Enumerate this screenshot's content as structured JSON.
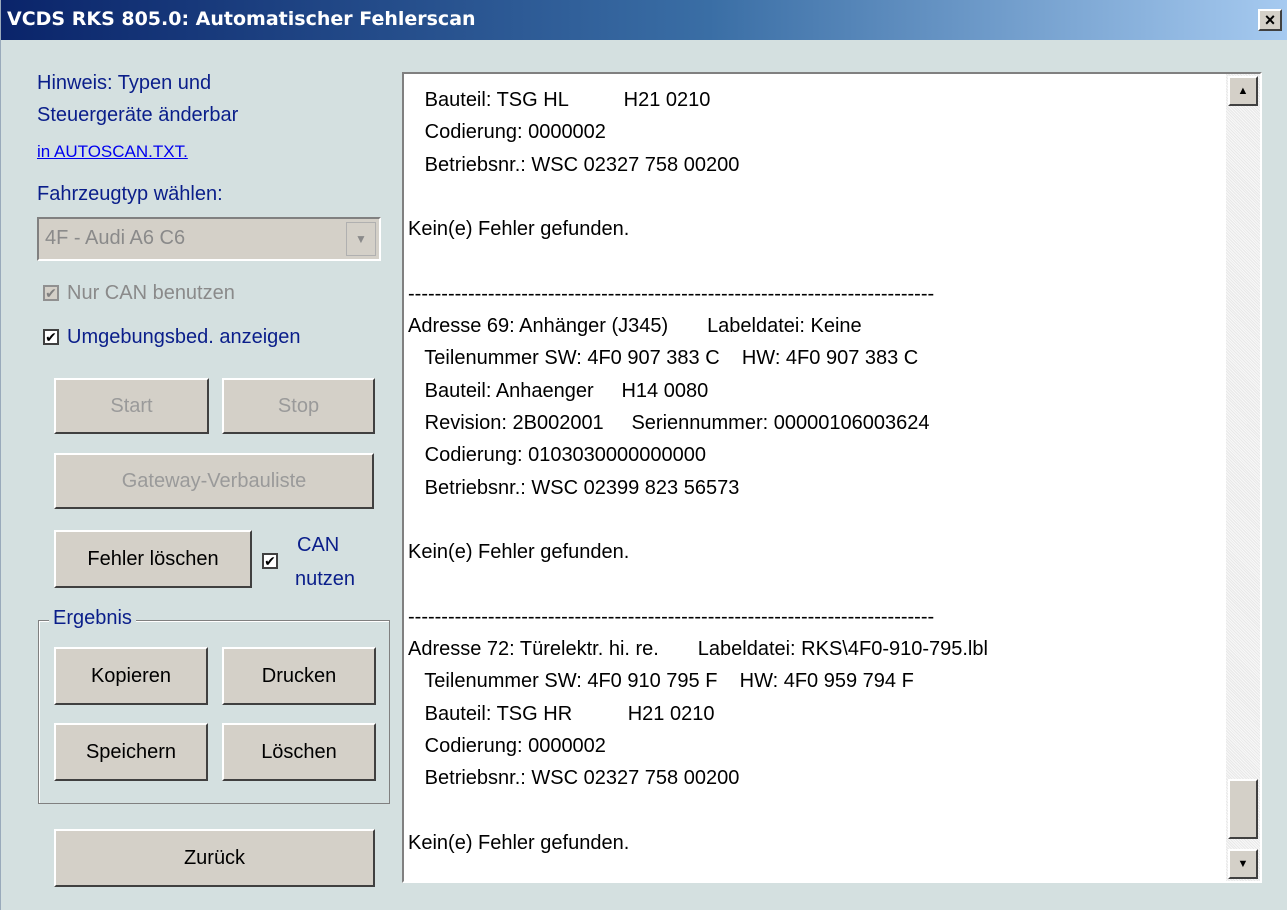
{
  "window": {
    "title": "VCDS RKS 805.0: Automatischer Fehlerscan",
    "close_label": "×"
  },
  "sidebar": {
    "hint_line1": "Hinweis: Typen und",
    "hint_line2": "Steuergeräte änderbar",
    "hint_link": "in AUTOSCAN.TXT.",
    "vehicle_label": "Fahrzeugtyp wählen:",
    "vehicle_select": {
      "value": "4F - Audi A6 C6",
      "arrow": "▼"
    },
    "can_only": {
      "label": "Nur CAN benutzen",
      "checked": true,
      "disabled": true,
      "mark": "✔"
    },
    "env_data": {
      "label": "Umgebungsbed. anzeigen",
      "checked": true,
      "mark": "✔"
    },
    "start_label": "Start",
    "stop_label": "Stop",
    "gateway_label": "Gateway-Verbauliste",
    "clear_errors_label": "Fehler löschen",
    "can_use": {
      "label_line1": "CAN",
      "label_line2": "nutzen",
      "checked": true,
      "mark": "✔"
    },
    "result_group": {
      "legend": "Ergebnis",
      "copy_label": "Kopieren",
      "print_label": "Drucken",
      "save_label": "Speichern",
      "delete_label": "Löschen"
    },
    "back_label": "Zurück"
  },
  "output": {
    "lines": [
      "   Bauteil: TSG HL          H21 0210",
      "   Codierung: 0000002",
      "   Betriebsnr.: WSC 02327 758 00200",
      "",
      "Kein(e) Fehler gefunden.",
      "",
      "-------------------------------------------------------------------------------",
      "Adresse 69: Anhänger (J345)       Labeldatei: Keine",
      "   Teilenummer SW: 4F0 907 383 C    HW: 4F0 907 383 C",
      "   Bauteil: Anhaenger     H14 0080",
      "   Revision: 2B002001     Seriennummer: 00000106003624",
      "   Codierung: 0103030000000000",
      "   Betriebsnr.: WSC 02399 823 56573",
      "",
      "Kein(e) Fehler gefunden.",
      "",
      "-------------------------------------------------------------------------------",
      "Adresse 72: Türelektr. hi. re.       Labeldatei: RKS\\4F0-910-795.lbl",
      "   Teilenummer SW: 4F0 910 795 F    HW: 4F0 959 794 F",
      "   Bauteil: TSG HR          H21 0210",
      "   Codierung: 0000002",
      "   Betriebsnr.: WSC 02327 758 00200",
      "",
      "Kein(e) Fehler gefunden."
    ],
    "scroll_up": "▲",
    "scroll_down": "▼"
  }
}
